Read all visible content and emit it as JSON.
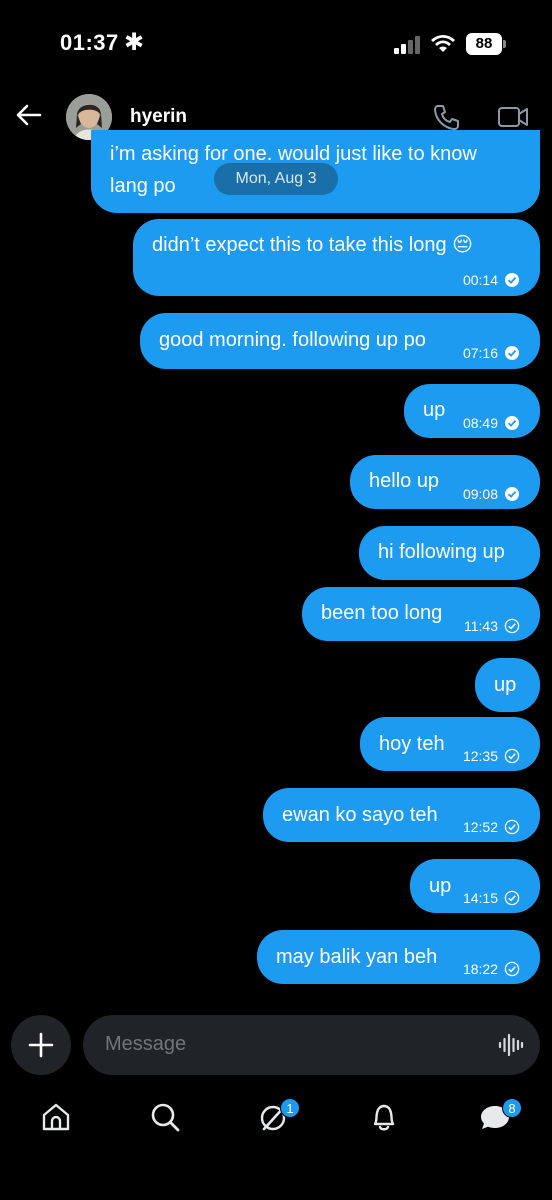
{
  "status_bar": {
    "time": "01:37",
    "indicator": "✱",
    "battery": "88"
  },
  "header": {
    "contact_name": "hyerin",
    "icons": [
      "back-arrow-icon",
      "phone-icon",
      "video-icon"
    ]
  },
  "date_separator": "Mon, Aug 3",
  "messages": [
    {
      "text_line1": "i’m asking for one. would just like to know",
      "text_line2": "lang po",
      "time": "",
      "read": null
    },
    {
      "text": "didn’t expect this to take this long 😔",
      "time": "00:14",
      "read": true
    },
    {
      "text": "good morning. following up po",
      "time": "07:16",
      "read": true
    },
    {
      "text": "up",
      "time": "08:49",
      "read": true
    },
    {
      "text": "hello up",
      "time": "09:08",
      "read": true
    },
    {
      "text": "hi following up",
      "time": "",
      "read": null
    },
    {
      "text": "been too long",
      "time": "11:43",
      "read": false
    },
    {
      "text": "up",
      "time": "",
      "read": null
    },
    {
      "text": "hoy teh",
      "time": "12:35",
      "read": false
    },
    {
      "text": "ewan ko sayo teh",
      "time": "12:52",
      "read": false
    },
    {
      "text": "up",
      "time": "14:15",
      "read": false
    },
    {
      "text": "may balik yan beh",
      "time": "18:22",
      "read": false
    }
  ],
  "composer": {
    "placeholder": "Message"
  },
  "nav": {
    "items": [
      "home-icon",
      "search-icon",
      "grok-icon",
      "notifications-icon",
      "messages-icon"
    ],
    "grok_badge": "1",
    "messages_badge": "8"
  },
  "colors": {
    "bubble": "#1d9bf0",
    "background": "#000000",
    "input": "#202327"
  }
}
